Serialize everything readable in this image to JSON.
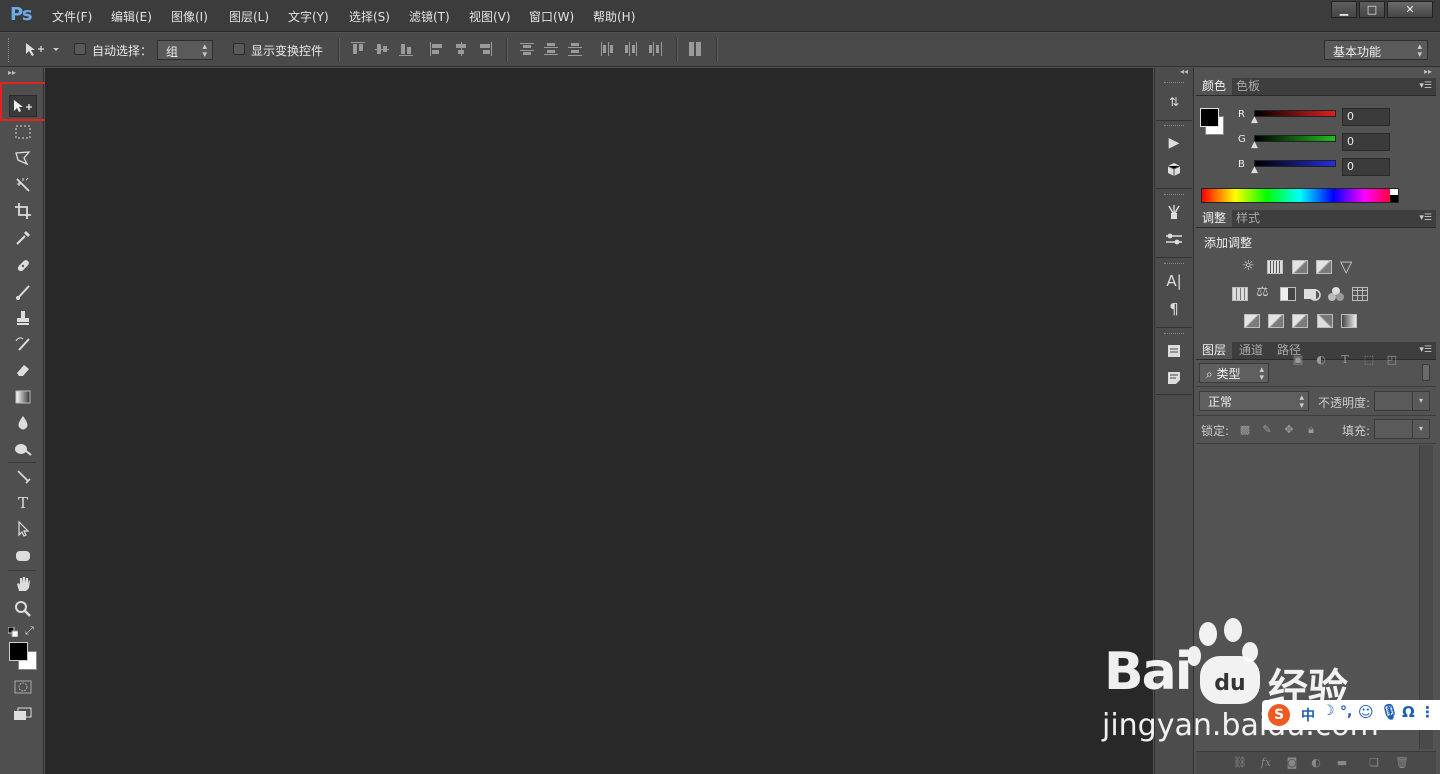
{
  "app": {
    "logo": "Ps"
  },
  "menubar": {
    "items": [
      "文件(F)",
      "编辑(E)",
      "图像(I)",
      "图层(L)",
      "文字(Y)",
      "选择(S)",
      "滤镜(T)",
      "视图(V)",
      "窗口(W)",
      "帮助(H)"
    ],
    "window_controls": [
      "▁",
      "□",
      "✕"
    ]
  },
  "options": {
    "auto_select_label": "自动选择：",
    "auto_select_value": "组",
    "show_transform_label": "显示变换控件",
    "workspace": "基本功能"
  },
  "panels": {
    "color": {
      "tabs": [
        "颜色",
        "色板"
      ],
      "channels": [
        {
          "label": "R",
          "value": "0",
          "color": "#e02020"
        },
        {
          "label": "G",
          "value": "0",
          "color": "#20c020"
        },
        {
          "label": "B",
          "value": "0",
          "color": "#2030e0"
        }
      ]
    },
    "adjustments": {
      "tabs": [
        "调整",
        "样式"
      ],
      "add_label": "添加调整"
    },
    "layers": {
      "tabs": [
        "图层",
        "通道",
        "路径"
      ],
      "filter_kind": "类型",
      "blend_mode": "正常",
      "opacity_label": "不透明度:",
      "lock_label": "锁定:",
      "fill_label": "填充:"
    }
  },
  "watermark": {
    "brand": "Bai",
    "brand2": "经验",
    "url": "jingyan.baidu.com",
    "ime": "中"
  },
  "colors": {
    "accent": "#6fa9e8",
    "highlight": "#e52222",
    "canvas": "#282828"
  }
}
